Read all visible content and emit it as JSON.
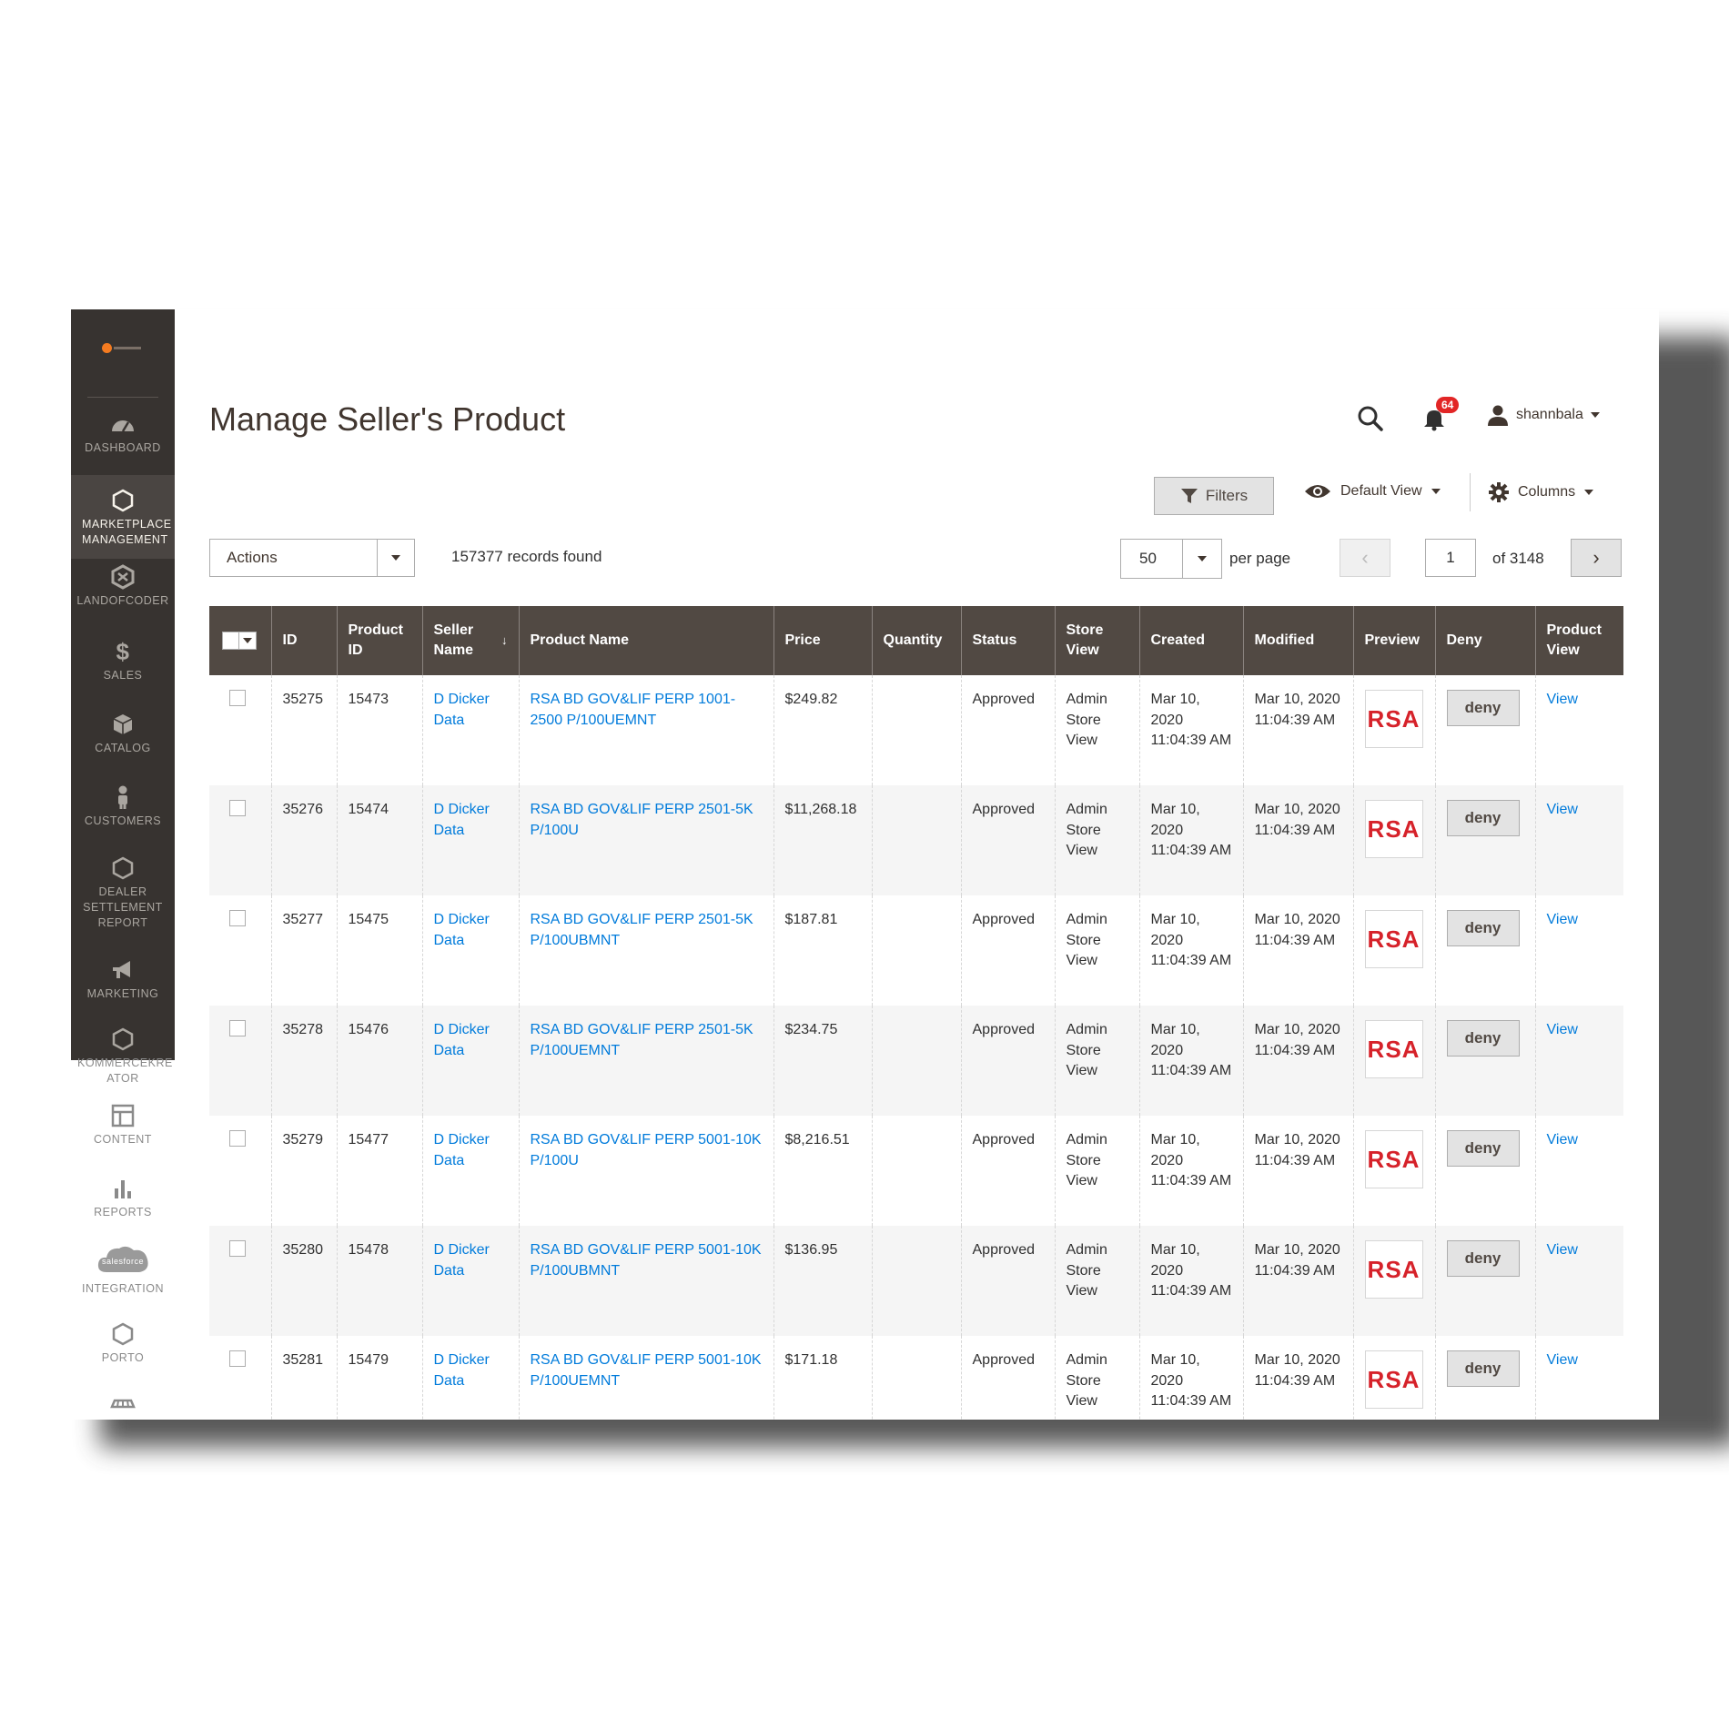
{
  "sidebar": {
    "items": [
      {
        "label": "DASHBOARD",
        "icon": "dashboard-icon"
      },
      {
        "label": "MARKETPLACE MANAGEMENT",
        "icon": "hexagon-icon"
      },
      {
        "label": "LANDOFCODER",
        "icon": "landofcoder-icon"
      },
      {
        "label": "SALES",
        "icon": "dollar-icon"
      },
      {
        "label": "CATALOG",
        "icon": "box-icon"
      },
      {
        "label": "CUSTOMERS",
        "icon": "person-icon"
      },
      {
        "label": "DEALER SETTLEMENT REPORT",
        "icon": "hexagon-icon"
      },
      {
        "label": "MARKETING",
        "icon": "megaphone-icon"
      },
      {
        "label": "KOMMERCEKRE ATOR",
        "icon": "hexagon-icon"
      },
      {
        "label": "CONTENT",
        "icon": "layout-icon"
      },
      {
        "label": "REPORTS",
        "icon": "bar-chart-icon"
      },
      {
        "label": "INTEGRATION",
        "icon": "salesforce-cloud-icon",
        "cloud_text": "salesforce"
      },
      {
        "label": "PORTO",
        "icon": "hexagon-icon"
      }
    ]
  },
  "header": {
    "title": "Manage Seller's Product",
    "notifications_count": "64",
    "username": "shannbala"
  },
  "toolbar": {
    "filters_label": "Filters",
    "view_label": "Default View",
    "columns_label": "Columns",
    "actions_label": "Actions",
    "records_found": "157377 records found",
    "per_page_value": "50",
    "per_page_label": "per page",
    "current_page": "1",
    "page_total": "of 3148"
  },
  "table": {
    "columns": [
      "ID",
      "Product ID",
      "Seller Name",
      "Product Name",
      "Price",
      "Quantity",
      "Status",
      "Store View",
      "Created",
      "Modified",
      "Preview",
      "Deny",
      "Product View"
    ],
    "rows": [
      {
        "id": "35275",
        "product_id": "15473",
        "seller": "D Dicker Data",
        "product_name": "RSA BD GOV&LIF PERP 1001-2500 P/100UEMNT",
        "price": "$249.82",
        "quantity": "",
        "status": "Approved",
        "store_view": "Admin Store View",
        "created": "Mar 10, 2020 11:04:39 AM",
        "modified": "Mar 10, 2020 11:04:39 AM",
        "preview": "RSA",
        "deny": "deny",
        "view": "View"
      },
      {
        "id": "35276",
        "product_id": "15474",
        "seller": "D Dicker Data",
        "product_name": "RSA BD GOV&LIF PERP 2501-5K P/100U",
        "price": "$11,268.18",
        "quantity": "",
        "status": "Approved",
        "store_view": "Admin Store View",
        "created": "Mar 10, 2020 11:04:39 AM",
        "modified": "Mar 10, 2020 11:04:39 AM",
        "preview": "RSA",
        "deny": "deny",
        "view": "View"
      },
      {
        "id": "35277",
        "product_id": "15475",
        "seller": "D Dicker Data",
        "product_name": "RSA BD GOV&LIF PERP 2501-5K P/100UBMNT",
        "price": "$187.81",
        "quantity": "",
        "status": "Approved",
        "store_view": "Admin Store View",
        "created": "Mar 10, 2020 11:04:39 AM",
        "modified": "Mar 10, 2020 11:04:39 AM",
        "preview": "RSA",
        "deny": "deny",
        "view": "View"
      },
      {
        "id": "35278",
        "product_id": "15476",
        "seller": "D Dicker Data",
        "product_name": "RSA BD GOV&LIF PERP 2501-5K P/100UEMNT",
        "price": "$234.75",
        "quantity": "",
        "status": "Approved",
        "store_view": "Admin Store View",
        "created": "Mar 10, 2020 11:04:39 AM",
        "modified": "Mar 10, 2020 11:04:39 AM",
        "preview": "RSA",
        "deny": "deny",
        "view": "View"
      },
      {
        "id": "35279",
        "product_id": "15477",
        "seller": "D Dicker Data",
        "product_name": "RSA BD GOV&LIF PERP 5001-10K P/100U",
        "price": "$8,216.51",
        "quantity": "",
        "status": "Approved",
        "store_view": "Admin Store View",
        "created": "Mar 10, 2020 11:04:39 AM",
        "modified": "Mar 10, 2020 11:04:39 AM",
        "preview": "RSA",
        "deny": "deny",
        "view": "View"
      },
      {
        "id": "35280",
        "product_id": "15478",
        "seller": "D Dicker Data",
        "product_name": "RSA BD GOV&LIF PERP 5001-10K P/100UBMNT",
        "price": "$136.95",
        "quantity": "",
        "status": "Approved",
        "store_view": "Admin Store View",
        "created": "Mar 10, 2020 11:04:39 AM",
        "modified": "Mar 10, 2020 11:04:39 AM",
        "preview": "RSA",
        "deny": "deny",
        "view": "View"
      },
      {
        "id": "35281",
        "product_id": "15479",
        "seller": "D Dicker Data",
        "product_name": "RSA BD GOV&LIF PERP 5001-10K P/100UEMNT",
        "price": "$171.18",
        "quantity": "",
        "status": "Approved",
        "store_view": "Admin Store View",
        "created": "Mar 10, 2020 11:04:39 AM",
        "modified": "Mar 10, 2020 11:04:39 AM",
        "preview": "RSA",
        "deny": "deny",
        "view": "View"
      }
    ]
  },
  "colors": {
    "sidebar_bg": "#373330",
    "header_bg": "#514943",
    "link": "#007bdb",
    "badge": "#e22626",
    "rsa_red": "#d6222a"
  }
}
